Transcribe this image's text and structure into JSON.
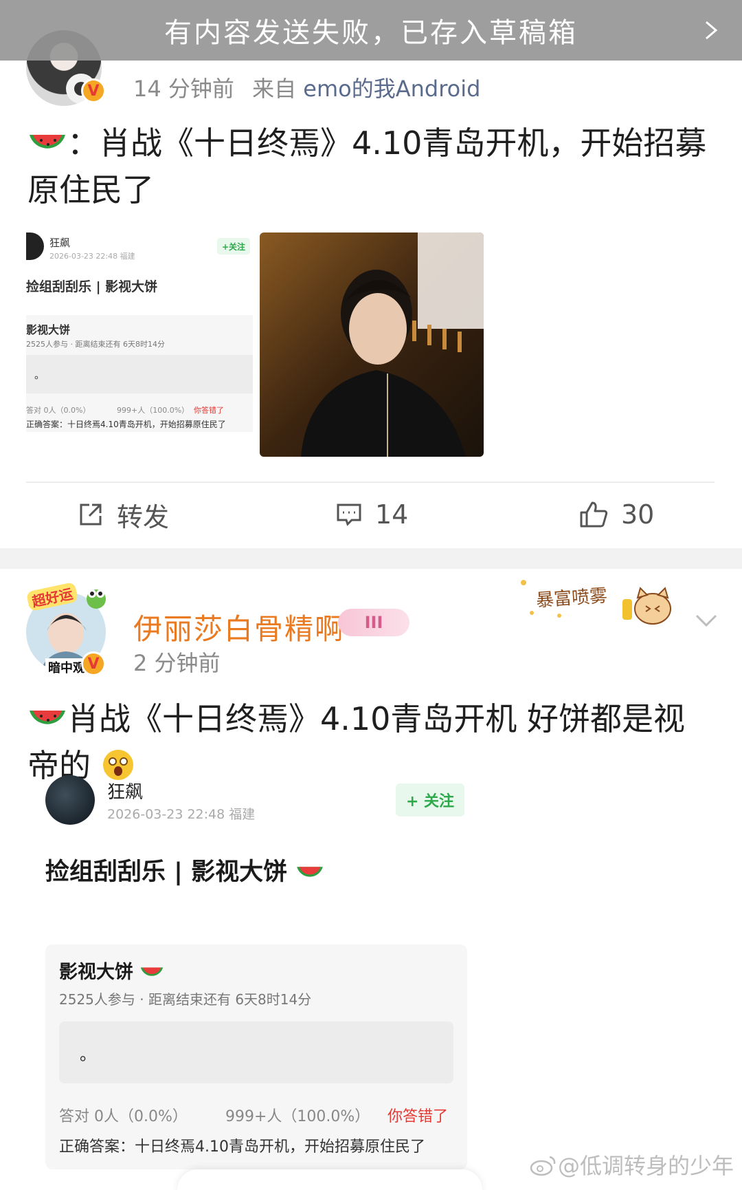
{
  "toast": {
    "text": "有内容发送失败，已存入草稿箱"
  },
  "post1": {
    "meta_time": "14 分钟前",
    "meta_from": "来自",
    "meta_source": "emo的我Android",
    "text": "：肖战《十日终焉》4.10青岛开机，开始招募原住民了",
    "card": {
      "user": "狂飙",
      "date": "2026-03-23 22:48  福建",
      "follow": "+关注",
      "title": "捡组刮刮乐 | 影视大饼",
      "poll_title": "影视大饼",
      "poll_sub": "2525人参与 · 距离结束还有 6天8时14分",
      "option": "。",
      "right_stat": "答对  0人（0.0%）",
      "wrong_stat": "999+人（100.0%）",
      "wrong_tag": "你答错了",
      "answer": "正确答案：十日终焉4.10青岛开机，开始招募原住民了"
    },
    "actions": {
      "repost": "转发",
      "comments": "14",
      "likes": "30"
    }
  },
  "post2": {
    "username": "伊丽莎白骨精啊",
    "level": "III",
    "avatar_tag": "超好运",
    "avatar_label": "暗中观",
    "deco_text": "暴富喷雾",
    "meta_time": "2 分钟前",
    "text": "肖战《十日终焉》4.10青岛开机  好饼都是视帝的",
    "card": {
      "user": "狂飙",
      "date": "2026-03-23 22:48  福建",
      "follow": "+ 关注",
      "title": "捡组刮刮乐 | 影视大饼",
      "poll_title": "影视大饼",
      "poll_sub": "2525人参与 · 距离结束还有 6天8时14分",
      "option": "。",
      "right_stat": "答对  0人（0.0%）",
      "wrong_stat": "999+人（100.0%）",
      "wrong_tag": "你答错了",
      "answer": "正确答案：十日终焉4.10青岛开机，开始招募原住民了"
    }
  },
  "watermark": "@低调转身的少年",
  "colors": {
    "orange": "#ea7a20",
    "link": "#5b6b8c",
    "green": "#2da84a",
    "red": "#e53935"
  }
}
